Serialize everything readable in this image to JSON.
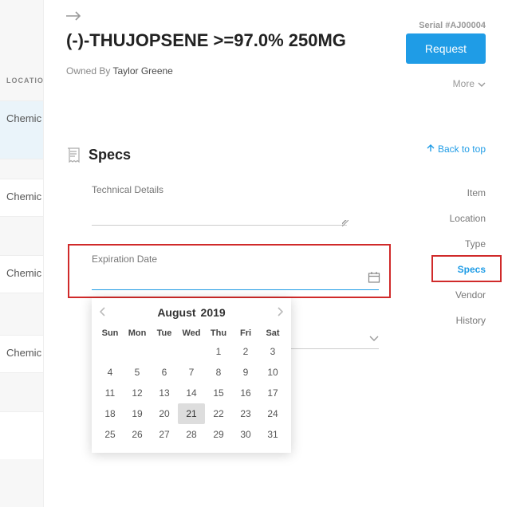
{
  "sidebar": {
    "header": "LOCATIO",
    "row_label": "Chemic"
  },
  "header": {
    "serial": "Serial #AJ00004",
    "title": "(-)-THUJOPSENE  >=97.0% 250MG",
    "owned_by_label": "Owned By",
    "owner": "Taylor Greene",
    "request": "Request",
    "more": "More"
  },
  "specs": {
    "back_to_top": "Back to top",
    "title": "Specs",
    "technical_details": "Technical Details",
    "expiration_label": "Expiration Date",
    "expiration_value": ""
  },
  "nav": {
    "items": [
      "Item",
      "Location",
      "Type",
      "Specs",
      "Vendor",
      "History"
    ],
    "active_index": 3
  },
  "calendar": {
    "month": "August",
    "year": "2019",
    "dow": [
      "Sun",
      "Mon",
      "Tue",
      "Wed",
      "Thu",
      "Fri",
      "Sat"
    ],
    "blanks": 4,
    "days": 31,
    "today": 21
  }
}
